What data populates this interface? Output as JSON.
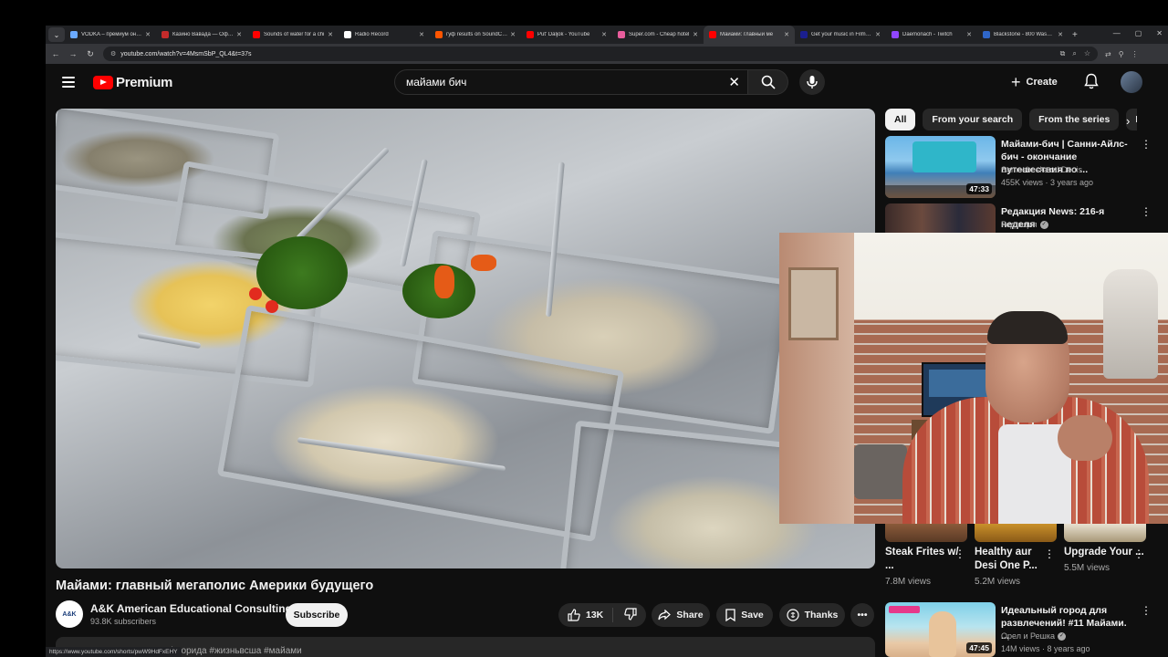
{
  "browser": {
    "tabs": [
      {
        "title": "VODKA – премиум онлай",
        "color": "#6aa9ff",
        "active": false
      },
      {
        "title": "Казино Вавада — Офиц",
        "color": "#c42b2b",
        "active": false
      },
      {
        "title": "Sounds of water for a chi",
        "color": "#ff0000",
        "active": false
      },
      {
        "title": "Radio Record",
        "color": "#ffffff",
        "active": false
      },
      {
        "title": "гуф results on SoundClou",
        "color": "#ff5500",
        "active": false
      },
      {
        "title": "Put' Daljok - YouTube",
        "color": "#ff0000",
        "active": false
      },
      {
        "title": "Super.com - Cheap hotel",
        "color": "#e85d9c",
        "active": false
      },
      {
        "title": "Майами: главный ме",
        "color": "#ff0000",
        "active": true
      },
      {
        "title": "Get your music in Films &",
        "color": "#1b1f8f",
        "active": false
      },
      {
        "title": "Daemonach - Twitch",
        "color": "#9146ff",
        "active": false
      },
      {
        "title": "Blackstone - 800 Washing",
        "color": "#2f66c8",
        "active": false
      }
    ],
    "url": "youtube.com/watch?v=4MsmSbP_QL4&t=37s",
    "status_url": "https://www.youtube.com/shorts/pwW9HdFxEHY"
  },
  "header": {
    "logo_text": "Premium",
    "search_value": "майами бич",
    "create_label": "Create"
  },
  "video": {
    "title": "Майами: главный мегаполис Америки будущего",
    "channel": "A&K American Educational Consulting",
    "channel_avatar_text": "A&K",
    "subscribers": "93.8K subscribers",
    "subscribe_label": "Subscribe",
    "likes": "13K",
    "share_label": "Share",
    "save_label": "Save",
    "thanks_label": "Thanks",
    "hashtags": "#флорида #жизньвсша #майами"
  },
  "chips": [
    "All",
    "From your search",
    "From the series",
    "Fro"
  ],
  "recommendations": [
    {
      "title": "Майами-бич | Санни-Айлс-бич - окончание путешествия по ...",
      "channel": "Samsebeskazal Denis",
      "meta": "455K views · 3 years ago",
      "duration": "47:33",
      "verified": false
    },
    {
      "title": "Редакция News: 216-я неделя",
      "channel": "Редакция",
      "meta": "",
      "duration": "",
      "verified": true
    },
    {
      "title": "Идеальный город для развлечений! #11 Майами. ...",
      "channel": "Орел и Решка",
      "meta": "14M views · 8 years ago",
      "duration": "47:45",
      "verified": true
    }
  ],
  "shorts": [
    {
      "title": "Steak Frites w/ ...",
      "views": "7.8M views"
    },
    {
      "title": "Healthy aur Desi One P...",
      "views": "5.2M views"
    },
    {
      "title": "Upgrade Your ...",
      "views": "5.5M views"
    }
  ],
  "colors": {
    "brand": "#ff0000",
    "background": "#0f0f0f",
    "chip": "#272727"
  }
}
